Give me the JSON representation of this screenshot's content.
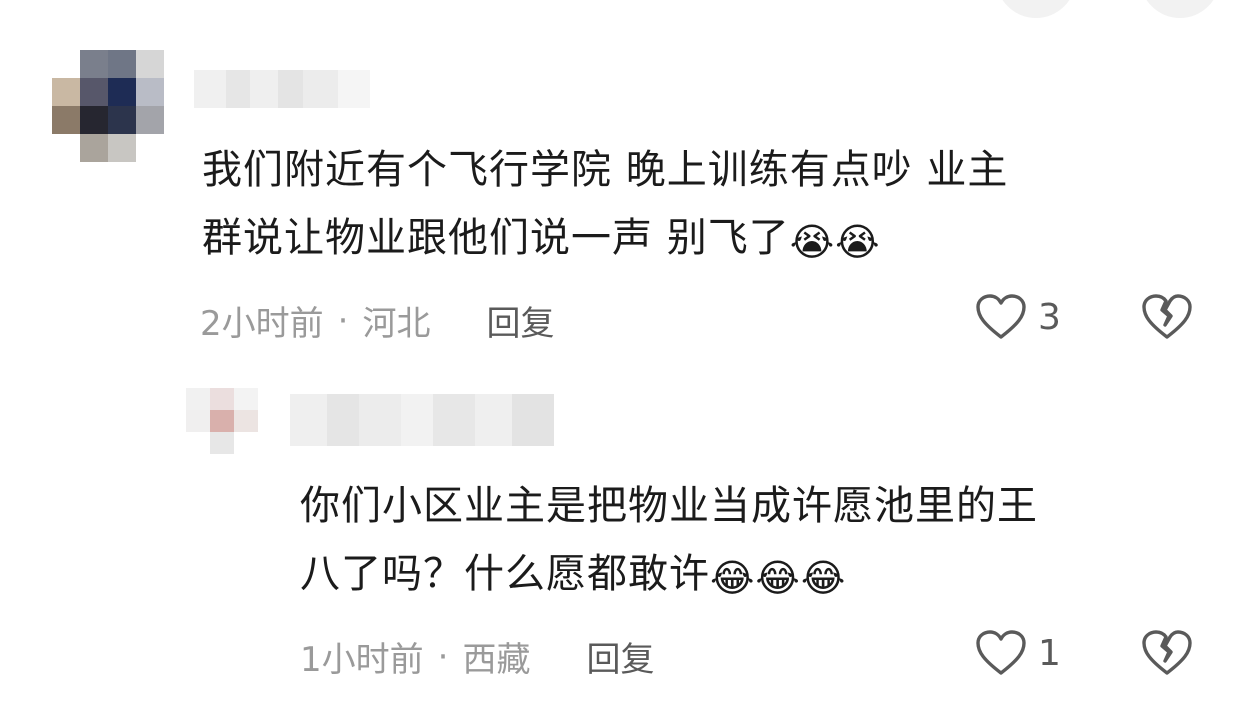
{
  "comments": [
    {
      "line1": "我们附近有个飞行学院  晚上训练有点吵 业主",
      "line2": "群说让物业跟他们说一声 别飞了",
      "emoji": "😭",
      "emoji_count": 2,
      "time": "2小时前",
      "separator": "·",
      "location": "河北",
      "reply_label": "回复",
      "like_count": "3"
    },
    {
      "line1": "你们小区业主是把物业当成许愿池里的王",
      "line2": "八了吗？什么愿都敢许",
      "emoji": "😂",
      "emoji_count": 3,
      "time": "1小时前",
      "separator": "·",
      "location": "西藏",
      "reply_label": "回复",
      "like_count": "1"
    }
  ],
  "icons": {
    "like": "heart-outline-icon",
    "dislike": "broken-heart-icon"
  },
  "colors": {
    "text": "#1b1b1b",
    "meta": "#9a9a9a",
    "action": "#5a5a5a"
  }
}
